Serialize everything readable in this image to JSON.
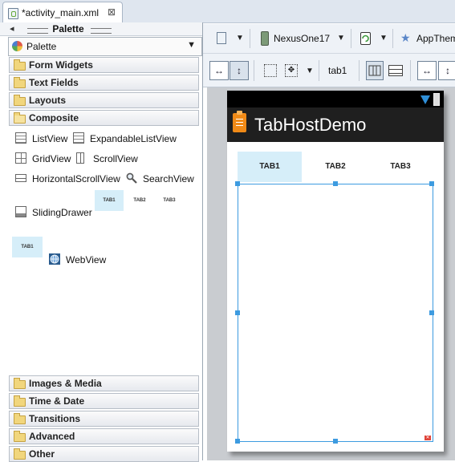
{
  "editor_tab": {
    "label": "*activity_main.xml",
    "close": "⊠"
  },
  "palette": {
    "header_title": "Palette",
    "header_arrow": "◂",
    "dropdown_value": "Palette",
    "categories_top": [
      {
        "label": "Form Widgets"
      },
      {
        "label": "Text Fields"
      },
      {
        "label": "Layouts"
      },
      {
        "label": "Composite"
      }
    ],
    "composite_widgets": [
      {
        "label": "ListView",
        "icon": "listview-icon"
      },
      {
        "label": "ExpandableListView",
        "icon": "expandable-listview-icon"
      },
      {
        "label": "GridView",
        "icon": "gridview-icon"
      },
      {
        "label": "ScrollView",
        "icon": "scrollview-icon"
      },
      {
        "label": "HorizontalScrollView",
        "icon": "horizontal-scrollview-icon"
      },
      {
        "label": "SearchView",
        "icon": "magnifier-icon"
      },
      {
        "label": "SlidingDrawer",
        "icon": "slidingdrawer-icon"
      },
      {
        "label": "WebView",
        "icon": "globe-icon"
      }
    ],
    "tabhost_preview_tabs": [
      "TAB1",
      "TAB2",
      "TAB3"
    ],
    "tabwidget_preview_tab": "TAB1",
    "categories_bottom": [
      {
        "label": "Images & Media"
      },
      {
        "label": "Time & Date"
      },
      {
        "label": "Transitions"
      },
      {
        "label": "Advanced"
      },
      {
        "label": "Other"
      }
    ]
  },
  "toolbar": {
    "device": "NexusOne17",
    "theme": "AppTheme",
    "selected_tab_id": "tab1"
  },
  "device_preview": {
    "app_title": "TabHostDemo",
    "tabs": [
      "TAB1",
      "TAB2",
      "TAB3"
    ],
    "selected_tab_index": 0
  },
  "colors": {
    "selection": "#3d9be0",
    "tab_selected_bg": "#d6eef9",
    "actionbar": "#1f1f1f",
    "app_icon": "#f08a17"
  }
}
